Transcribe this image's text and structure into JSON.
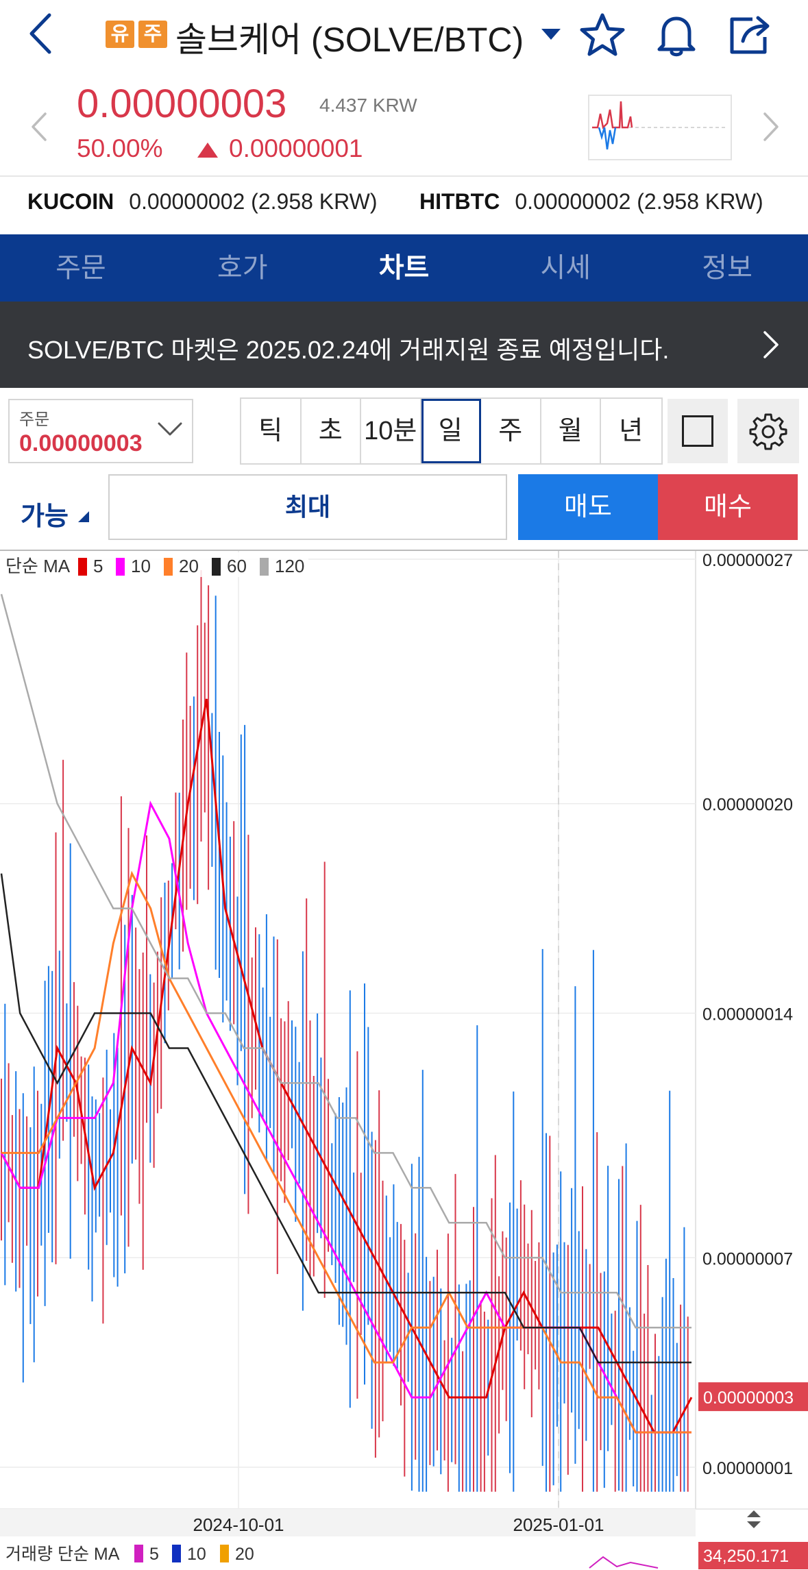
{
  "header": {
    "badges": [
      "유",
      "주"
    ],
    "title": "솔브케어 (SOLVE/BTC)",
    "icons": [
      "back-icon",
      "caret-down-icon",
      "star-icon",
      "bell-icon",
      "share-icon"
    ]
  },
  "ticker": {
    "price": "0.00000003",
    "krw": "4.437 KRW",
    "change_pct": "50.00%",
    "change_abs": "0.00000001",
    "colors": {
      "up": "#d8374a",
      "down": "#1b7ae6"
    }
  },
  "exchanges": [
    {
      "name": "KUCOIN",
      "value": "0.00000002 (2.958 KRW)"
    },
    {
      "name": "HITBTC",
      "value": "0.00000002 (2.958 KRW)"
    }
  ],
  "tabs": [
    {
      "label": "주문",
      "active": false
    },
    {
      "label": "호가",
      "active": false
    },
    {
      "label": "차트",
      "active": true
    },
    {
      "label": "시세",
      "active": false
    },
    {
      "label": "정보",
      "active": false
    }
  ],
  "notice": {
    "text": "SOLVE/BTC 마켓은 2025.02.24에 거래지원 종료 예정입니다."
  },
  "order": {
    "label": "주문",
    "value": "0.00000003",
    "periods": [
      {
        "label": "틱",
        "active": false
      },
      {
        "label": "초",
        "active": false
      },
      {
        "label": "10분",
        "active": false
      },
      {
        "label": "일",
        "active": true
      },
      {
        "label": "주",
        "active": false
      },
      {
        "label": "월",
        "active": false
      },
      {
        "label": "년",
        "active": false
      }
    ]
  },
  "trade": {
    "available": "가능",
    "max": "최대",
    "sell": "매도",
    "buy": "매수"
  },
  "chart_data": {
    "type": "candlestick",
    "interval": "daily",
    "legend": {
      "prefix": "단순 MA",
      "items": [
        {
          "label": "5",
          "color": "#e00000"
        },
        {
          "label": "10",
          "color": "#ff00ff"
        },
        {
          "label": "20",
          "color": "#ff7f2a"
        },
        {
          "label": "60",
          "color": "#222222"
        },
        {
          "label": "120",
          "color": "#aaaaaa"
        }
      ]
    },
    "y_ticks": [
      "0.00000027",
      "0.00000020",
      "0.00000014",
      "0.00000007",
      "0.00000001"
    ],
    "x_ticks": [
      "2024-10-01",
      "2025-01-01"
    ],
    "current_price_label": "0.00000003",
    "grid": true,
    "volume_legend": {
      "prefix": "거래량 단순 MA",
      "items": [
        {
          "label": "5",
          "color": "#d020c0"
        },
        {
          "label": "10",
          "color": "#1030c0"
        },
        {
          "label": "20",
          "color": "#f0a000"
        }
      ]
    },
    "volume_label": "34,250.171",
    "ma_series": [
      {
        "name": "5",
        "values": [
          0.1,
          0.09,
          0.09,
          0.13,
          0.12,
          0.09,
          0.1,
          0.13,
          0.12,
          0.16,
          0.2,
          0.23,
          0.17,
          0.15,
          0.13,
          0.12,
          0.11,
          0.1,
          0.09,
          0.08,
          0.07,
          0.06,
          0.05,
          0.04,
          0.03,
          0.03,
          0.03,
          0.05,
          0.06,
          0.05,
          0.05,
          0.05,
          0.05,
          0.04,
          0.03,
          0.02,
          0.02,
          0.03
        ]
      },
      {
        "name": "10",
        "values": [
          0.1,
          0.09,
          0.09,
          0.11,
          0.11,
          0.11,
          0.12,
          0.17,
          0.2,
          0.19,
          0.16,
          0.14,
          0.13,
          0.12,
          0.11,
          0.1,
          0.09,
          0.08,
          0.07,
          0.06,
          0.05,
          0.04,
          0.03,
          0.03,
          0.04,
          0.05,
          0.06,
          0.05,
          0.05,
          0.05,
          0.05,
          0.05,
          0.04,
          0.03,
          0.02,
          0.02,
          0.02,
          0.02
        ]
      },
      {
        "name": "20",
        "values": [
          0.1,
          0.1,
          0.1,
          0.11,
          0.12,
          0.13,
          0.16,
          0.18,
          0.17,
          0.15,
          0.14,
          0.13,
          0.12,
          0.11,
          0.1,
          0.09,
          0.08,
          0.07,
          0.06,
          0.05,
          0.04,
          0.04,
          0.05,
          0.05,
          0.06,
          0.05,
          0.05,
          0.05,
          0.05,
          0.05,
          0.04,
          0.04,
          0.03,
          0.03,
          0.02,
          0.02,
          0.02,
          0.02
        ]
      },
      {
        "name": "60",
        "values": [
          0.18,
          0.14,
          0.13,
          0.12,
          0.13,
          0.14,
          0.14,
          0.14,
          0.14,
          0.13,
          0.13,
          0.12,
          0.11,
          0.1,
          0.09,
          0.08,
          0.07,
          0.06,
          0.06,
          0.06,
          0.06,
          0.06,
          0.06,
          0.06,
          0.06,
          0.06,
          0.06,
          0.06,
          0.05,
          0.05,
          0.05,
          0.05,
          0.04,
          0.04,
          0.04,
          0.04,
          0.04,
          0.04
        ]
      },
      {
        "name": "120",
        "values": [
          0.26,
          0.24,
          0.22,
          0.2,
          0.19,
          0.18,
          0.17,
          0.17,
          0.16,
          0.15,
          0.15,
          0.14,
          0.14,
          0.13,
          0.13,
          0.12,
          0.12,
          0.12,
          0.11,
          0.11,
          0.1,
          0.1,
          0.09,
          0.09,
          0.08,
          0.08,
          0.08,
          0.07,
          0.07,
          0.07,
          0.06,
          0.06,
          0.06,
          0.06,
          0.05,
          0.05,
          0.05,
          0.05
        ]
      }
    ]
  }
}
